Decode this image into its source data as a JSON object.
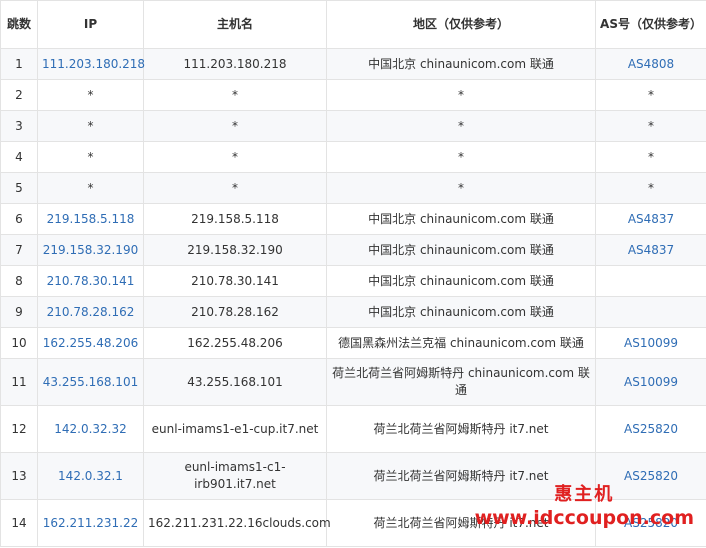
{
  "headers": {
    "hop": "跳数",
    "ip": "IP",
    "hostname": "主机名",
    "region": "地区（仅供参考）",
    "as": "AS号（仅供参考）"
  },
  "rows": [
    {
      "hop": "1",
      "ip": "111.203.180.218",
      "host": "111.203.180.218",
      "region": "中国北京 chinaunicom.com 联通",
      "as": "AS4808"
    },
    {
      "hop": "2",
      "ip": "*",
      "host": "*",
      "region": "*",
      "as": "*"
    },
    {
      "hop": "3",
      "ip": "*",
      "host": "*",
      "region": "*",
      "as": "*"
    },
    {
      "hop": "4",
      "ip": "*",
      "host": "*",
      "region": "*",
      "as": "*"
    },
    {
      "hop": "5",
      "ip": "*",
      "host": "*",
      "region": "*",
      "as": "*"
    },
    {
      "hop": "6",
      "ip": "219.158.5.118",
      "host": "219.158.5.118",
      "region": "中国北京 chinaunicom.com 联通",
      "as": "AS4837"
    },
    {
      "hop": "7",
      "ip": "219.158.32.190",
      "host": "219.158.32.190",
      "region": "中国北京 chinaunicom.com 联通",
      "as": "AS4837"
    },
    {
      "hop": "8",
      "ip": "210.78.30.141",
      "host": "210.78.30.141",
      "region": "中国北京 chinaunicom.com 联通",
      "as": ""
    },
    {
      "hop": "9",
      "ip": "210.78.28.162",
      "host": "210.78.28.162",
      "region": "中国北京 chinaunicom.com 联通",
      "as": ""
    },
    {
      "hop": "10",
      "ip": "162.255.48.206",
      "host": "162.255.48.206",
      "region": "德国黑森州法兰克福 chinaunicom.com 联通",
      "as": "AS10099"
    },
    {
      "hop": "11",
      "ip": "43.255.168.101",
      "host": "43.255.168.101",
      "region": "荷兰北荷兰省阿姆斯特丹 chinaunicom.com 联通",
      "as": "AS10099"
    },
    {
      "hop": "12",
      "ip": "142.0.32.32",
      "host": "eunl-imams1-e1-cup.it7.net",
      "region": "荷兰北荷兰省阿姆斯特丹 it7.net",
      "as": "AS25820"
    },
    {
      "hop": "13",
      "ip": "142.0.32.1",
      "host": "eunl-imams1-c1-irb901.it7.net",
      "region": "荷兰北荷兰省阿姆斯特丹 it7.net",
      "as": "AS25820"
    },
    {
      "hop": "14",
      "ip": "162.211.231.22",
      "host": "162.211.231.22.16clouds.com",
      "region": "荷兰北荷兰省阿姆斯特丹 it7.net",
      "as": "AS25820"
    }
  ],
  "watermark": {
    "line1": "惠主机",
    "line2": "www.idccoupon.com"
  },
  "colors": {
    "link": "#2f6db5",
    "border": "#e3e3e3",
    "stripe": "#f7f8fa",
    "watermark": "#e02020"
  }
}
